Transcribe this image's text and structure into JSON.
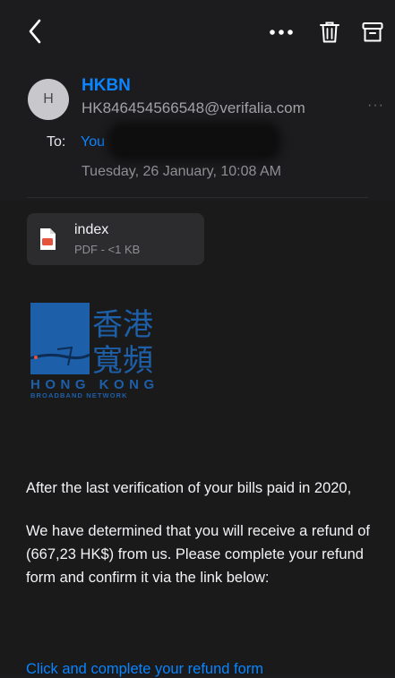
{
  "colors": {
    "accent": "#0a84ff",
    "background": "#1c1c1e",
    "logo_blue": "#1d5fa8"
  },
  "toolbar": {
    "back_icon": "chevron-left-icon",
    "more_icon": "more-horizontal-icon",
    "trash_icon": "trash-icon",
    "archive_icon": "archive-icon"
  },
  "message": {
    "avatar_initial": "H",
    "sender_name": "HKBN",
    "sender_email": "HK846454566548@verifalia.com",
    "sender_more": "···",
    "to_label": "To:",
    "to_value": "You",
    "date": "Tuesday, 26 January, 10:08 AM"
  },
  "attachment": {
    "name": "index",
    "meta": "PDF - <1 KB",
    "icon": "pdf-file-icon"
  },
  "logo": {
    "chars_top": "香港",
    "chars_bottom": "寬頻",
    "line1": "HONG KONG",
    "line2": "BROADBAND NETWORK"
  },
  "body": {
    "paragraph1": "After the last verification of your bills paid in 2020,",
    "paragraph2": "We have determined that you will receive a refund of (667,23 HK$) from us. Please complete your refund form and confirm it via the link below:",
    "link": "Click and complete your refund form"
  }
}
